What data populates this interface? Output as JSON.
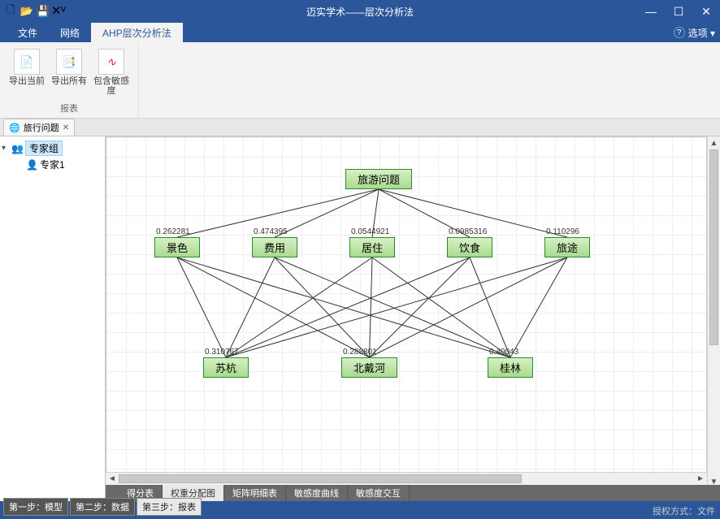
{
  "app": {
    "title": "迈实学术——层次分析法"
  },
  "qat": [
    "🗋",
    "📂",
    "💾",
    "🗙˅"
  ],
  "winbtns": {
    "min": "—",
    "max": "☐",
    "close": "✕"
  },
  "menutabs": {
    "file": "文件",
    "network": "网络",
    "method": "AHP层次分析法"
  },
  "menu_options": {
    "label": "选项 ▾",
    "help": "?"
  },
  "ribbon": {
    "group_label": "报表",
    "export_current": "导出当前",
    "export_all": "导出所有",
    "sensitivity": "包含敏感度"
  },
  "doctab": {
    "label": "旅行问题",
    "close": "✕"
  },
  "tree": {
    "root": "专家组",
    "child1": "专家1"
  },
  "chart_data": {
    "type": "hierarchy-graph",
    "goal": {
      "label": "旅游问题"
    },
    "criteria": [
      {
        "label": "景色",
        "weight": 0.262281
      },
      {
        "label": "费用",
        "weight": 0.474395
      },
      {
        "label": "居住",
        "weight": 0.0544921
      },
      {
        "label": "饮食",
        "weight": 0.0985316
      },
      {
        "label": "旅途",
        "weight": 0.110296
      }
    ],
    "alternatives": [
      {
        "label": "苏杭",
        "weight": 0.310767
      },
      {
        "label": "北戴河",
        "weight": 0.288801
      },
      {
        "label": "桂林",
        "weight": 0.40043
      }
    ],
    "edges_goal_to_criteria": true,
    "edges_criteria_to_alternatives": "full-bipartite"
  },
  "innertabs": {
    "scores": "得分表",
    "weights": "权重分配图",
    "matrix": "矩阵明细表",
    "sens_curve": "敏感度曲线",
    "sens_inter": "敏感度交互"
  },
  "steptabs": {
    "s1": "第一步：模型",
    "s2": "第二步：数据",
    "s3": "第三步：报表"
  },
  "status": "授权方式：文件"
}
